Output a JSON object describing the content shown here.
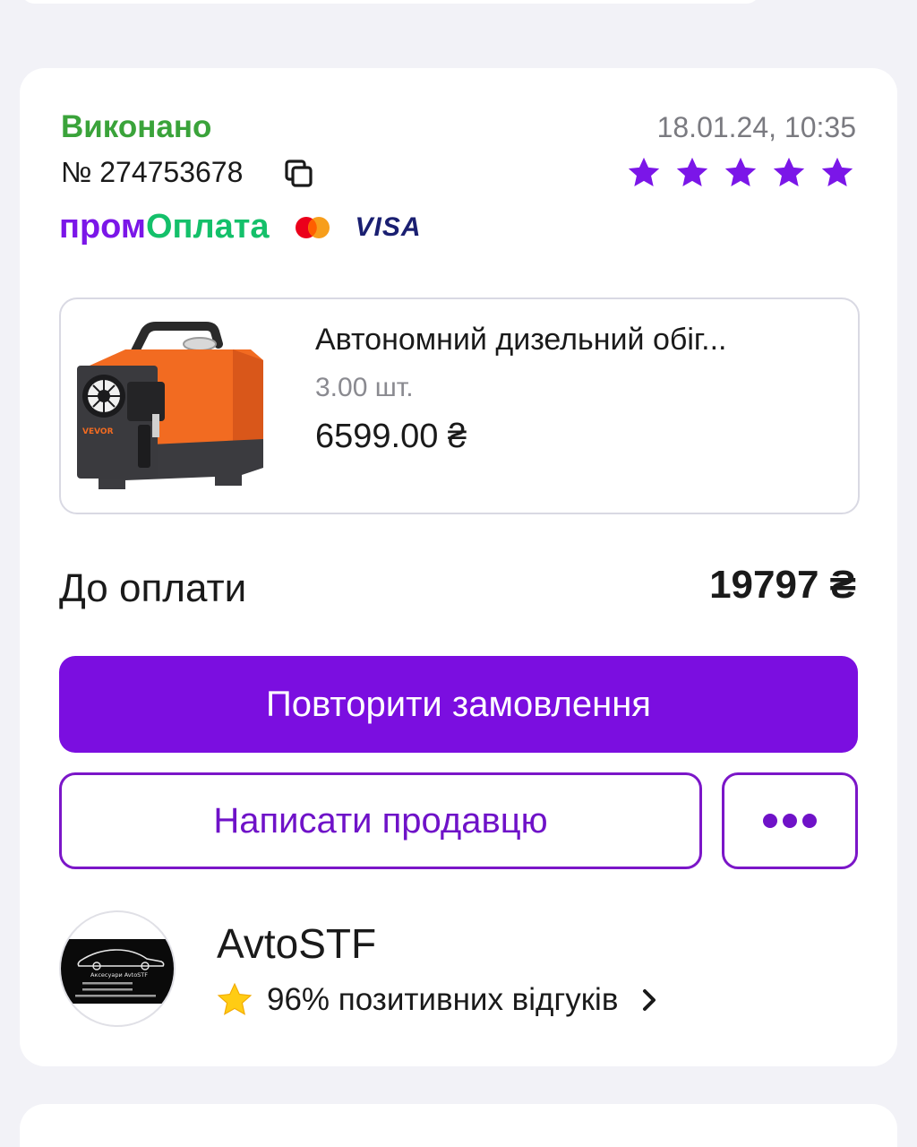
{
  "order": {
    "status": "Виконано",
    "datetime": "18.01.24, 10:35",
    "number": "№ 274753678",
    "rating_stars": 5,
    "colors": {
      "status": "#3aa33a",
      "accent": "#7b0ee0",
      "star": "#7b16e8"
    }
  },
  "payment": {
    "prom_part1": "пром",
    "prom_part2": "Оплата",
    "card_brands": [
      "mastercard-icon",
      "Visa"
    ],
    "visa_label": "VISA"
  },
  "product": {
    "name": "Автономний дизельний обіг...",
    "quantity": "3.00 шт.",
    "price": "6599.00 ₴",
    "image_brand": "VEVOR"
  },
  "total": {
    "label": "До оплати",
    "value": "19797 ₴"
  },
  "actions": {
    "repeat_label": "Повторити замовлення",
    "write_label": "Написати продавцю",
    "more_icon": "more-dots-icon"
  },
  "seller": {
    "name": "AvtoSTF",
    "rating_text": "96% позитивних відгуків",
    "logo_text": "Аксесуари AvtoSTF"
  }
}
